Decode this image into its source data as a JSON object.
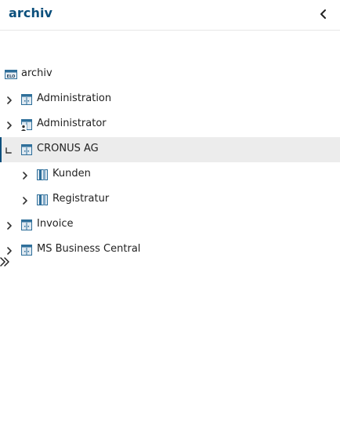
{
  "panel": {
    "title": "archiv"
  },
  "tree": {
    "root": {
      "label": "archiv",
      "icon": "elo-archive-icon"
    },
    "items": [
      {
        "label": "Administration",
        "icon": "cabinet-icon",
        "state": "collapsed"
      },
      {
        "label": "Administrator",
        "icon": "user-cabinet-icon",
        "state": "collapsed"
      },
      {
        "label": "CRONUS AG",
        "icon": "cabinet-icon",
        "state": "expanded",
        "selected": true,
        "children": [
          {
            "label": "Kunden",
            "icon": "folder-icon",
            "state": "collapsed"
          },
          {
            "label": "Registratur",
            "icon": "folder-icon",
            "state": "collapsed"
          }
        ]
      },
      {
        "label": "Invoice",
        "icon": "cabinet-icon",
        "state": "collapsed"
      },
      {
        "label": "MS Business Central",
        "icon": "cabinet-icon",
        "state": "collapsed"
      }
    ]
  },
  "colors": {
    "accent": "#0b4f7c",
    "selected_bg": "#ececec",
    "icon_blue": "#2f6f9a"
  }
}
